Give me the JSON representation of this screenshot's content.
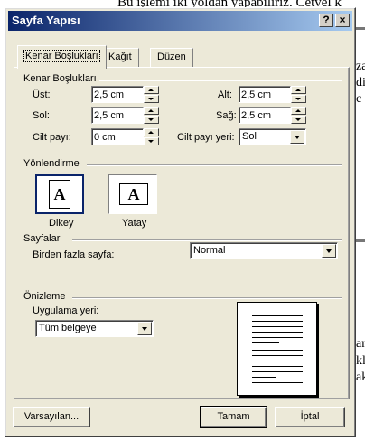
{
  "background": {
    "top_text": "Bu işlemi iki yoldan yapabiliriz. Cetvel k",
    "right_fragments": [
      "za",
      "di",
      "c",
      "ar",
      "kl",
      "ak"
    ]
  },
  "dialog": {
    "title": "Sayfa Yapısı",
    "help_label": "?",
    "close_label": "×"
  },
  "tabs": [
    {
      "label": "Kenar Boşlukları",
      "active": true
    },
    {
      "label": "Kağıt",
      "active": false
    },
    {
      "label": "Düzen",
      "active": false
    }
  ],
  "margins": {
    "group_label": "Kenar Boşlukları",
    "top_label": "Üst:",
    "top_value": "2,5 cm",
    "bottom_label": "Alt:",
    "bottom_value": "2,5 cm",
    "left_label": "Sol:",
    "left_value": "2,5 cm",
    "right_label": "Sağ:",
    "right_value": "2,5 cm",
    "gutter_label": "Cilt payı:",
    "gutter_value": "0 cm",
    "gutter_pos_label": "Cilt payı yeri:",
    "gutter_pos_value": "Sol"
  },
  "orientation": {
    "group_label": "Yönlendirme",
    "portrait_label": "Dikey",
    "landscape_label": "Yatay",
    "icon_letter": "A",
    "selected": "portrait"
  },
  "pages": {
    "group_label": "Sayfalar",
    "multiple_label": "Birden fazla sayfa:",
    "multiple_value": "Normal"
  },
  "preview": {
    "group_label": "Önizleme",
    "apply_label": "Uygulama yeri:",
    "apply_value": "Tüm belgeye"
  },
  "buttons": {
    "default_label": "Varsayılan...",
    "ok_label": "Tamam",
    "cancel_label": "İptal"
  }
}
